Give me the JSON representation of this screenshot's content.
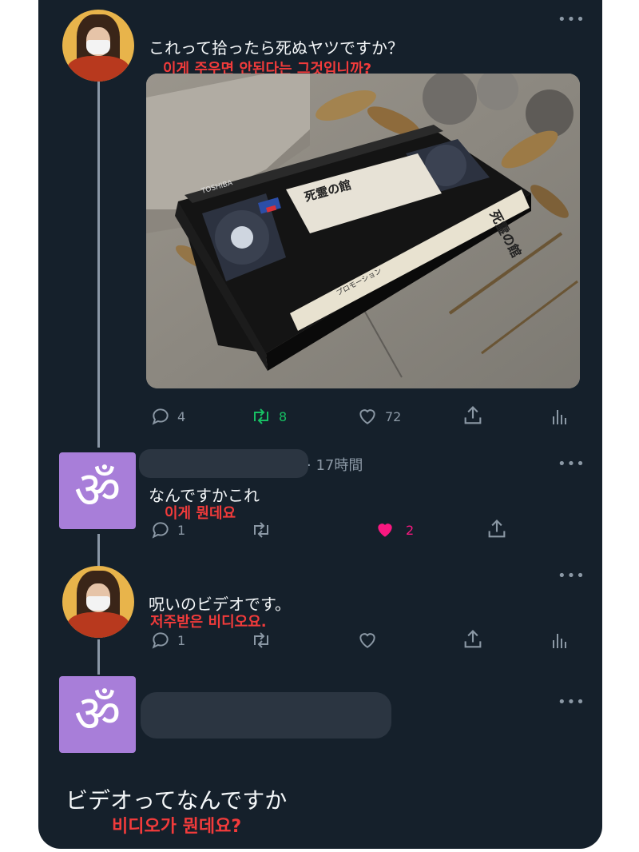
{
  "tweet1": {
    "text": "これって拾ったら死ぬヤツですか？",
    "translation": "이게  주우면 안된다는 그것입니까?",
    "more": "•••",
    "stats": {
      "replies": "4",
      "retweets": "8",
      "likes": "72"
    },
    "image": {
      "brand": "TOSHIBA",
      "label_title": "死霊の館",
      "spine_title": "死霊の館",
      "spine_sub": "プロモーション"
    },
    "colors": {
      "retweet": "#17bf63"
    }
  },
  "tweet2": {
    "time": "· 17時間",
    "text": "なんですかこれ",
    "translation": "이게 뭔데요",
    "more": "•••",
    "stats": {
      "replies": "1",
      "likes": "2"
    },
    "avatar_glyph": "ॐ",
    "colors": {
      "like": "#f91880"
    }
  },
  "tweet3": {
    "text": "呪いのビデオです。",
    "translation": "저주받은 비디오요.",
    "more": "•••",
    "stats": {
      "replies": "1"
    }
  },
  "tweet4": {
    "text": "ビデオってなんですか",
    "translation": "비디오가 뭔데요?",
    "more": "•••",
    "avatar_glyph": "ॐ"
  }
}
